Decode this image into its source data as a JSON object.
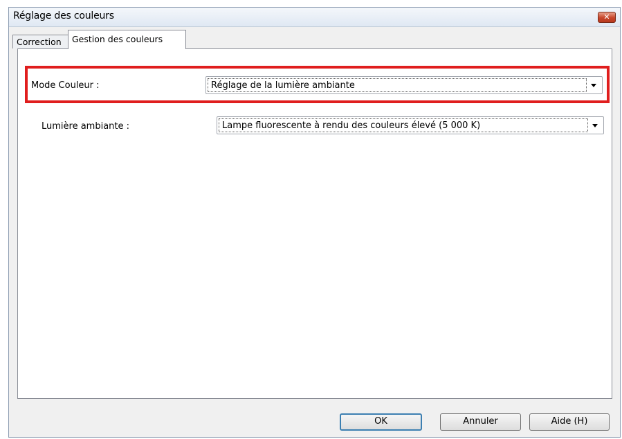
{
  "window": {
    "title": "Réglage des couleurs",
    "close_label": "✕"
  },
  "tabs": [
    {
      "label": "Correction",
      "active": false
    },
    {
      "label": "Gestion des couleurs",
      "active": true
    }
  ],
  "fields": {
    "mode_couleur": {
      "label": "Mode Couleur :",
      "value": "Réglage de la lumière ambiante"
    },
    "lumiere_ambiante": {
      "label": "Lumière ambiante :",
      "value": "Lampe fluorescente à rendu des couleurs élevé (5 000 K)"
    }
  },
  "buttons": {
    "ok": "OK",
    "annuler": "Annuler",
    "aide": "Aide (H)"
  },
  "colors": {
    "highlight": "#e01e1e",
    "close_button": "#c7462b",
    "default_button_border": "#3c7fb1"
  }
}
